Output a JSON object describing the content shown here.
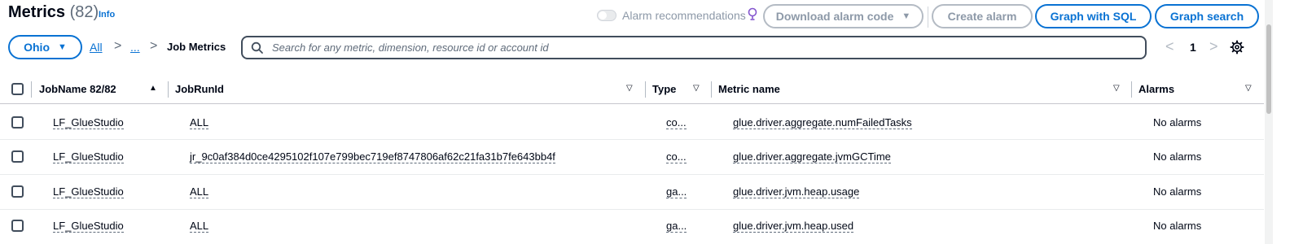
{
  "header": {
    "title": "Metrics",
    "count": "(82)",
    "info_label": "Info",
    "alarm_recommendations_label": "Alarm recommendations",
    "buttons": {
      "download_alarm_code": "Download alarm code",
      "create_alarm": "Create alarm",
      "graph_with_sql": "Graph with SQL",
      "graph_search": "Graph search"
    }
  },
  "toolbar": {
    "region": "Ohio",
    "breadcrumb": {
      "all": "All",
      "sep1": ">",
      "ellipsis": "...",
      "sep2": ">",
      "current": "Job Metrics"
    },
    "search": {
      "placeholder": "Search for any metric, dimension, resource id or account id",
      "value": ""
    },
    "pagination": {
      "prev": "<",
      "page": "1",
      "next": ">"
    }
  },
  "table": {
    "columns": {
      "jobname": "JobName 82/82",
      "jobrunid": "JobRunId",
      "type": "Type",
      "metric_name": "Metric name",
      "alarms": "Alarms"
    },
    "sort_asc_glyph": "▲",
    "filter_glyph": "▽",
    "rows": [
      {
        "jobname": "LF_GlueStudio",
        "jobrunid": "ALL",
        "type": "co...",
        "metric_name": "glue.driver.aggregate.numFailedTasks",
        "alarms": "No alarms"
      },
      {
        "jobname": "LF_GlueStudio",
        "jobrunid": "jr_9c0af384d0ce4295102f107e799bec719ef8747806af62c21fa31b7fe643bb4f",
        "type": "co...",
        "metric_name": "glue.driver.aggregate.jvmGCTime",
        "alarms": "No alarms"
      },
      {
        "jobname": "LF_GlueStudio",
        "jobrunid": "ALL",
        "type": "ga...",
        "metric_name": "glue.driver.jvm.heap.usage",
        "alarms": "No alarms"
      },
      {
        "jobname": "LF_GlueStudio",
        "jobrunid": "ALL",
        "type": "ga...",
        "metric_name": "glue.driver.jvm.heap.used",
        "alarms": "No alarms"
      }
    ]
  },
  "colors": {
    "accent": "#0972d3",
    "text": "#000716",
    "muted": "#5f6b7a",
    "disabled": "#8d99a8",
    "bulb": "#8456ce"
  },
  "icons": [
    "lightbulb-icon",
    "caret-down-icon",
    "search-icon",
    "chevron-left-icon",
    "chevron-right-icon",
    "gear-icon",
    "sort-asc-icon",
    "filter-icon"
  ]
}
